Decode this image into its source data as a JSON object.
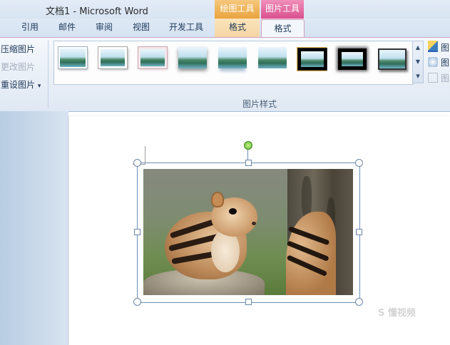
{
  "window": {
    "title": "文档1 - Microsoft Word"
  },
  "contextual_groups": {
    "drawing_tools": "绘图工具",
    "picture_tools": "图片工具"
  },
  "tabs": [
    {
      "label": "引用"
    },
    {
      "label": "邮件"
    },
    {
      "label": "审阅"
    },
    {
      "label": "视图"
    },
    {
      "label": "开发工具"
    },
    {
      "label": "格式"
    },
    {
      "label": "格式",
      "selected": true
    }
  ],
  "adjust_group": {
    "compress": "压缩图片",
    "change": "更改图片",
    "reset": "重设图片",
    "reset_arrow": "▾"
  },
  "styles_group": {
    "label": "图片样式",
    "selected_style": 7
  },
  "right_group": {
    "border": "图",
    "effects": "图",
    "layout": "图"
  },
  "gallery_controls": {
    "up": "▲",
    "down": "▼",
    "more": "▾"
  },
  "watermark": "S 懂视频",
  "colors": {
    "picture_tools": "#d9508e",
    "drawing_tools": "#e9a43e",
    "ribbon": "#dfe8f3"
  }
}
